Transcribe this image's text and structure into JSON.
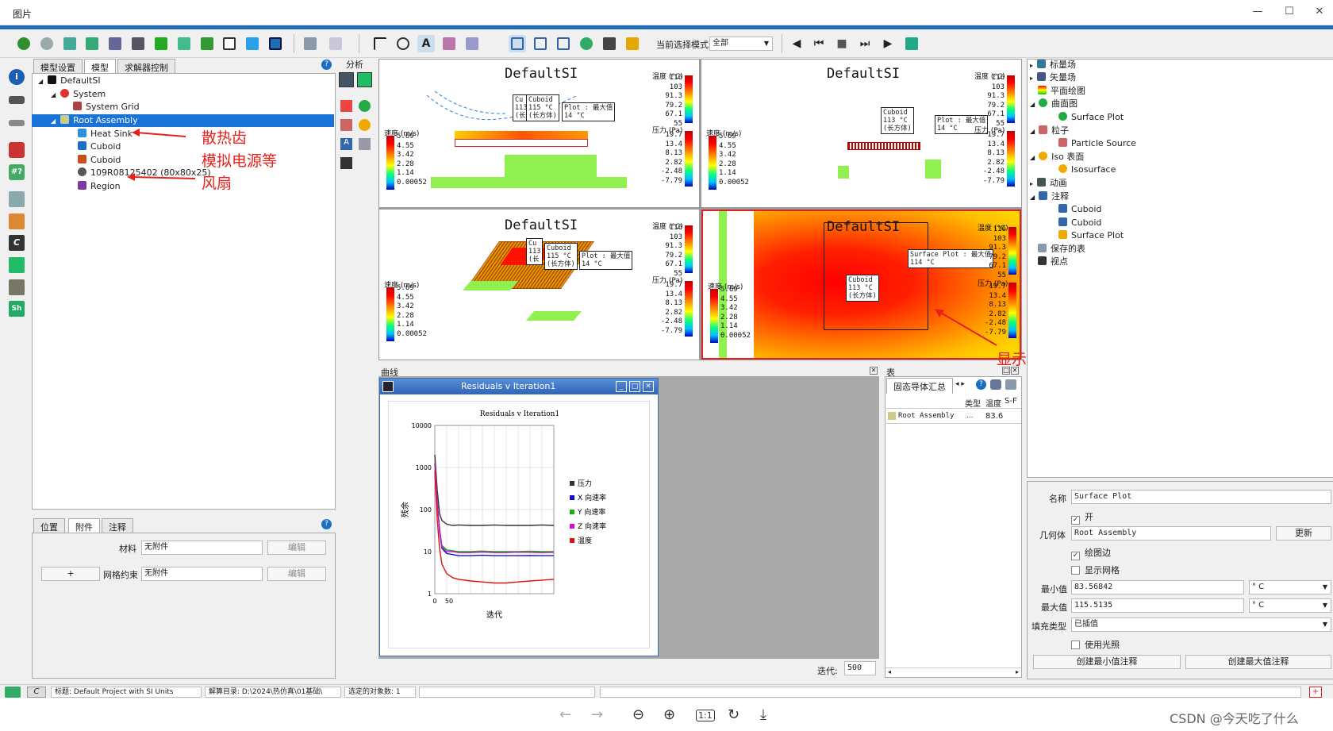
{
  "window": {
    "title": "图片",
    "min": "—",
    "max": "☐",
    "close": "✕",
    "restore": "⧉"
  },
  "toolbar": {
    "select_mode_label": "当前选择模式",
    "select_mode_value": "全部"
  },
  "left_panel": {
    "tabs": [
      "模型设置",
      "模型",
      "求解器控制"
    ],
    "analysis_label": "分析",
    "tree": [
      {
        "label": "DefaultSI"
      },
      {
        "label": "System"
      },
      {
        "label": "System Grid"
      },
      {
        "label": "Root Assembly"
      },
      {
        "label": "Heat Sink"
      },
      {
        "label": "Cuboid"
      },
      {
        "label": "Cuboid"
      },
      {
        "label": "109R08125402 (80x80x25)"
      },
      {
        "label": "Region"
      }
    ],
    "annotations": [
      "散热齿",
      "模拟电源等",
      "风扇"
    ],
    "bottom_tabs": [
      "位置",
      "附件",
      "注释"
    ],
    "material_label": "材料",
    "material_value": "无附件",
    "edit_label": "编辑",
    "plus_label": "+",
    "mesh_label": "网格约束",
    "mesh_value": "无附件"
  },
  "viewports": {
    "title": "DefaultSI",
    "velocity_unit": "速度 (m/s)",
    "temp_unit": "温度 (°C)",
    "pressure_unit": "压力 (Pa)",
    "velocity_ticks": [
      "5.69",
      "4.55",
      "3.42",
      "2.28",
      "1.14",
      "0.00052"
    ],
    "temp_ticks": [
      "116",
      "103",
      "91.3",
      "79.2",
      "67.1",
      "55"
    ],
    "pressure_ticks": [
      "19.7",
      "13.4",
      "8.13",
      "2.82",
      "-2.48",
      "-7.79"
    ],
    "callout_cuboid": "Cuboid",
    "callout_cuboid_val": "115 °C",
    "callout_cuboid_sub": "(长方体)",
    "callout_cuboid2_val": "113 °C",
    "callout_plot": "Plot : 最大值",
    "callout_plot_val": "14 °C",
    "callout_surface": "Surface Plot : 最大值",
    "callout_surface_val": "114 °C",
    "callout_cu": "Cu",
    "callout_cu_val": "113",
    "callout_cu_sub": "(长",
    "max_temp_annotation": "显示最高温"
  },
  "curves": {
    "panel_label": "曲线",
    "window_title": "Residuals v Iteration1",
    "chart_title": "Residuals v Iteration1",
    "ylabel": "残余",
    "xlabel": "迭代",
    "y_ticks": [
      "10000",
      "1000",
      "100",
      "10",
      "1"
    ],
    "x_ticks": [
      "0",
      "50"
    ],
    "legend": [
      "压力",
      "X 向速率",
      "Y 向速率",
      "Z 向速率",
      "温度"
    ],
    "iter_label": "迭代:",
    "iter_value": "500"
  },
  "chart_data": {
    "type": "line",
    "title": "Residuals v Iteration1",
    "xlabel": "迭代",
    "ylabel": "残余",
    "yscale": "log",
    "ylim": [
      1,
      10000
    ],
    "x": [
      0,
      10,
      20,
      30,
      50,
      75,
      100,
      150,
      200,
      250,
      300,
      350,
      400,
      450,
      500
    ],
    "series": [
      {
        "name": "压力",
        "color": "#333333",
        "values": [
          2000,
          300,
          80,
          55,
          45,
          42,
          43,
          42,
          42,
          43,
          42,
          42,
          42,
          43,
          42
        ]
      },
      {
        "name": "X 向速率",
        "color": "#1010d0",
        "values": [
          1200,
          150,
          30,
          12,
          9,
          8.5,
          8,
          8,
          8.2,
          8,
          8,
          8,
          8.1,
          8,
          8
        ]
      },
      {
        "name": "Y 向速率",
        "color": "#10b010",
        "values": [
          1300,
          160,
          35,
          14,
          11,
          10.5,
          10,
          10,
          10.3,
          10,
          10,
          10,
          10.2,
          10,
          10
        ]
      },
      {
        "name": "Z 向速率",
        "color": "#d010d0",
        "values": [
          1250,
          155,
          33,
          13,
          10,
          10,
          9.5,
          9.5,
          9.8,
          9.5,
          9.5,
          9.7,
          9.6,
          9.5,
          9.6
        ]
      },
      {
        "name": "温度",
        "color": "#e01010",
        "values": [
          800,
          60,
          12,
          5,
          3,
          2.4,
          2.2,
          2,
          1.9,
          1.8,
          1.8,
          1.9,
          2,
          2.1,
          2.2
        ]
      }
    ]
  },
  "table": {
    "panel_label": "表",
    "tab_label": "固态导体汇总",
    "col_type": "类型",
    "col_temp": "温度",
    "col_sf": "S-F",
    "row_name": "Root Assembly",
    "row_type": "...",
    "row_value": "83.6"
  },
  "right_tree": [
    {
      "label": "标量场"
    },
    {
      "label": "矢量场"
    },
    {
      "label": "平面绘图"
    },
    {
      "label": "曲面图"
    },
    {
      "label": "Surface Plot"
    },
    {
      "label": "粒子"
    },
    {
      "label": "Particle Source"
    },
    {
      "label": "Iso 表面"
    },
    {
      "label": "Isosurface"
    },
    {
      "label": "动画"
    },
    {
      "label": "注释"
    },
    {
      "label": "Cuboid"
    },
    {
      "label": "Cuboid"
    },
    {
      "label": "Surface Plot"
    },
    {
      "label": "保存的表"
    },
    {
      "label": "视点"
    }
  ],
  "properties": {
    "name_label": "名称",
    "name_value": "Surface Plot",
    "on_label": "开",
    "geom_label": "几何体",
    "geom_value": "Root Assembly",
    "update_label": "更新",
    "draw_edges_label": "绘图边",
    "show_mesh_label": "显示网格",
    "min_label": "最小值",
    "min_value": "83.56842",
    "max_label": "最大值",
    "max_value": "115.5135",
    "unit": "° C",
    "fill_label": "填充类型",
    "fill_value": "已插值",
    "lighting_label": "使用光照",
    "create_min_label": "创建最小值注释",
    "create_max_label": "创建最大值注释"
  },
  "status": {
    "title": "标题: Default Project with SI Units",
    "dir": "解算目录: D:\\2024\\热仿真\\01基础\\",
    "selected": "选定的对象数: 1"
  },
  "watermark": "CSDN @今天吃了什么"
}
